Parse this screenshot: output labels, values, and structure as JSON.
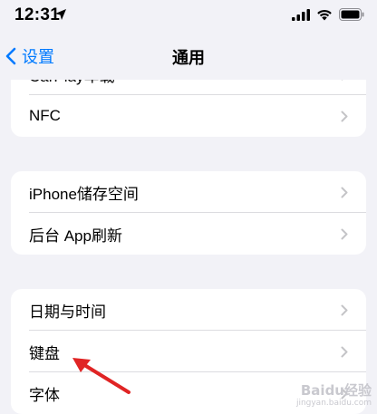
{
  "status_bar": {
    "time": "12:31"
  },
  "nav": {
    "back_label": "设置",
    "title": "通用"
  },
  "group1": {
    "cut_item": "CarPlay车载",
    "items": [
      "NFC"
    ]
  },
  "group2": {
    "items": [
      "iPhone储存空间",
      "后台 App刷新"
    ]
  },
  "group3": {
    "items": [
      "日期与时间",
      "键盘",
      "字体"
    ]
  },
  "annotation": {
    "color": "#e02424"
  },
  "watermark": {
    "text": "Baidu经验",
    "sub": "jingyan.baidu.com"
  },
  "colors": {
    "accent": "#007aff",
    "background": "#f2f2f7",
    "chevron": "#c4c4c7"
  }
}
